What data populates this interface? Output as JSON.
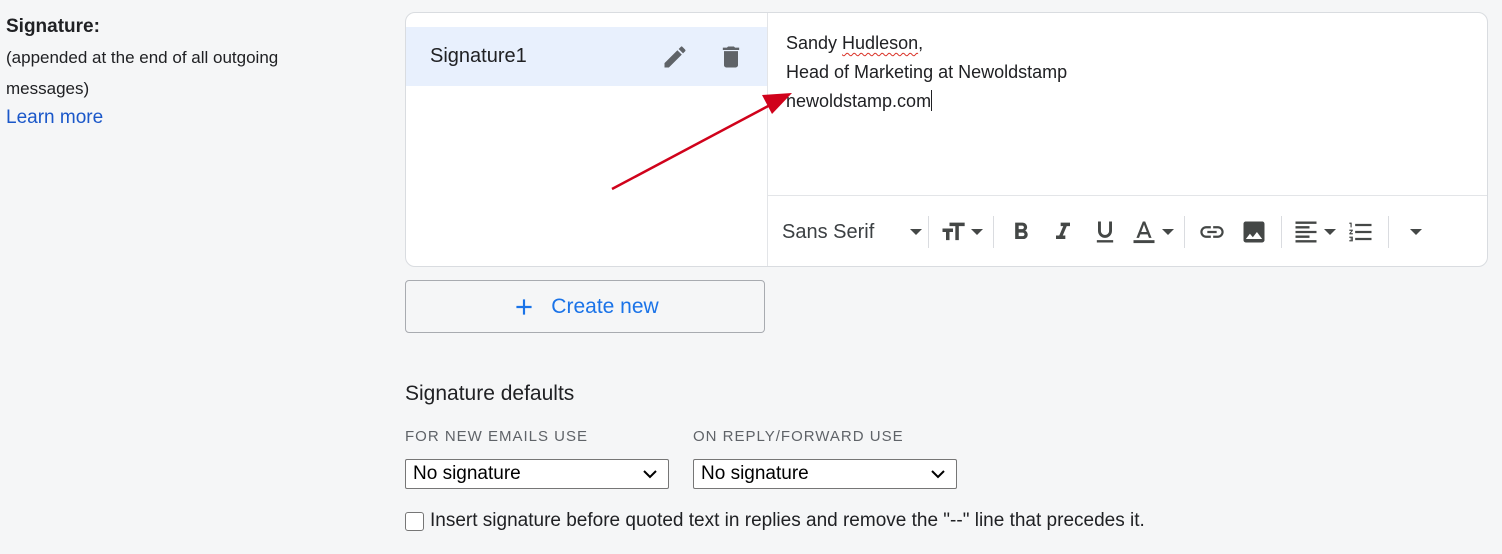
{
  "signature_section": {
    "title": "Signature:",
    "description": "(appended at the end of all outgoing messages)",
    "learn_more": "Learn more"
  },
  "signature_list": {
    "items": [
      {
        "name": "Signature1",
        "selected": true,
        "edit_icon": "pencil-icon",
        "delete_icon": "trash-icon"
      }
    ]
  },
  "editor": {
    "lines": [
      "Sandy Hudleson,",
      "Head of Marketing at Newoldstamp",
      "newoldstamp.com"
    ],
    "spellcheck_flagged_word": "Hudleson"
  },
  "toolbar": {
    "font_family": "Sans Serif",
    "buttons": [
      "text-size-icon",
      "bold-icon",
      "italic-icon",
      "underline-icon",
      "text-color-icon",
      "link-icon",
      "image-icon",
      "align-icon",
      "numbered-list-icon",
      "more-formatting-icon"
    ]
  },
  "create_new": {
    "label": "Create new",
    "icon": "plus-icon"
  },
  "defaults": {
    "title": "Signature defaults",
    "new_emails_label": "FOR NEW EMAILS USE",
    "new_emails_value": "No signature",
    "reply_forward_label": "ON REPLY/FORWARD USE",
    "reply_forward_value": "No signature"
  },
  "insert_before_quoted": {
    "checked": false,
    "label": "Insert signature before quoted text in replies and remove the \"--\" line that precedes it."
  },
  "colors": {
    "background": "#f5f6f7",
    "link": "#1a57c9",
    "accent": "#1a73e8",
    "selected_item": "#e8f0fd",
    "annotation_arrow": "#d0021b"
  }
}
